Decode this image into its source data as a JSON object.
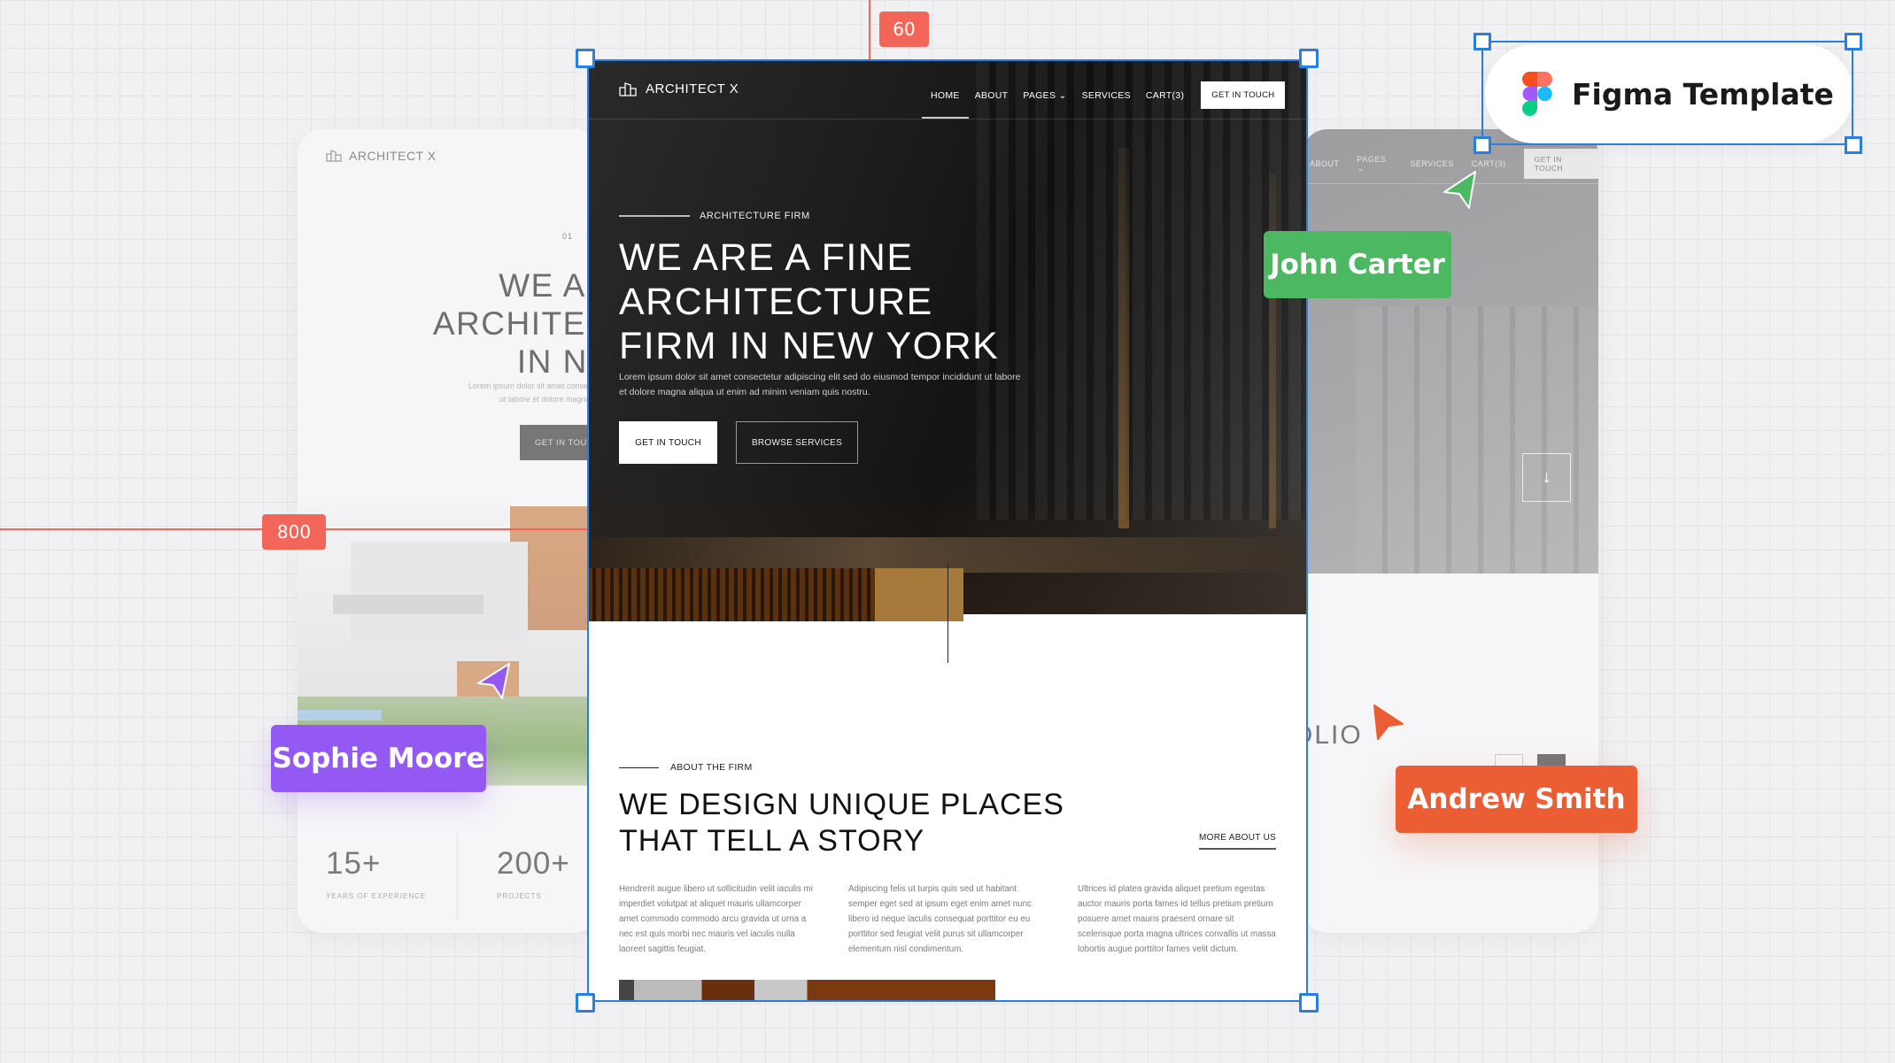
{
  "canvas": {
    "rulers": {
      "vertical_value": "60",
      "horizontal_value": "800"
    },
    "badge": {
      "label": "Figma Template",
      "icon": "figma-logo-icon"
    },
    "collaborators": [
      {
        "name": "Sophie Moore",
        "color": "#9459F2",
        "icon": "cursor-arrow-icon"
      },
      {
        "name": "John Carter",
        "color": "#4DB862",
        "icon": "cursor-arrow-icon"
      },
      {
        "name": "Andrew Smith",
        "color": "#EB5E33",
        "icon": "cursor-arrow-icon"
      }
    ],
    "selection_color": "#2A7DE1",
    "ruler_color": "#F2665A"
  },
  "left_card": {
    "logo": "ARCHITECT X",
    "slide_number": "01",
    "title_lines": [
      "WE AR",
      "ARCHITEC",
      "IN NE"
    ],
    "subtitle_lines": [
      "Lorem ipsum dolor sit amet consecte",
      "ut labore et dolore magna al"
    ],
    "button": "GET IN TOUCH",
    "stats": [
      {
        "value": "15+",
        "label": "YEARS OF EXPERIENCE"
      },
      {
        "value": "200+",
        "label": "PROJECTS"
      }
    ]
  },
  "right_card": {
    "nav": [
      "ABOUT",
      "PAGES",
      "SERVICES",
      "CART(3)"
    ],
    "cta": "GET IN TOUCH",
    "section_title": "OLIO",
    "prev_label": "‹",
    "next_label": "›",
    "scroll_down": "↓"
  },
  "main": {
    "logo": "ARCHITECT X",
    "nav": [
      {
        "label": "HOME",
        "active": true
      },
      {
        "label": "ABOUT",
        "active": false
      },
      {
        "label": "PAGES",
        "active": false,
        "dropdown": true
      },
      {
        "label": "SERVICES",
        "active": false
      },
      {
        "label": "CART(3)",
        "active": false
      }
    ],
    "nav_cta": "GET IN TOUCH",
    "hero": {
      "eyebrow": "ARCHITECTURE FIRM",
      "title": "WE ARE A FINE\nARCHITECTURE\nFIRM IN NEW YORK",
      "lead": "Lorem ipsum dolor sit amet consectetur adipiscing elit sed do eiusmod tempor incididunt ut labore et dolore magna aliqua ut enim ad minim veniam quis nostru.",
      "primary_button": "GET IN TOUCH",
      "secondary_button": "BROWSE SERVICES"
    },
    "about": {
      "eyebrow": "ABOUT THE FIRM",
      "title": "WE DESIGN UNIQUE PLACES\nTHAT TELL A STORY",
      "link": "MORE ABOUT US",
      "columns": [
        "Hendrerit augue libero ut sollicitudin velit iaculis mi  imperdiet volutpat at aliquet mauris ullamcorper amet  commodo commodo arcu gravida ut urna  a nec est quis morbi nec mauris vel iaculis nulla laoreet sagittis feugiat.",
        "Adipiscing felis ut turpis quis sed ut habitant semper eget sed at ipsum eget enim amet  nunc libero id neque iaculis consequat porttitor eu  eu porttitor sed feugiat velit purus sit ullamcorper elementum nisl condimentum.",
        "Ultrices id platea gravida aliquet pretium egestas auctor mauris porta fames id tellus pretium pretium posuere amet mauris praesent ornare sit scelerisque porta magna ultrices convallis ut massa lobortis augue porttitor fames velit dictum."
      ]
    }
  }
}
